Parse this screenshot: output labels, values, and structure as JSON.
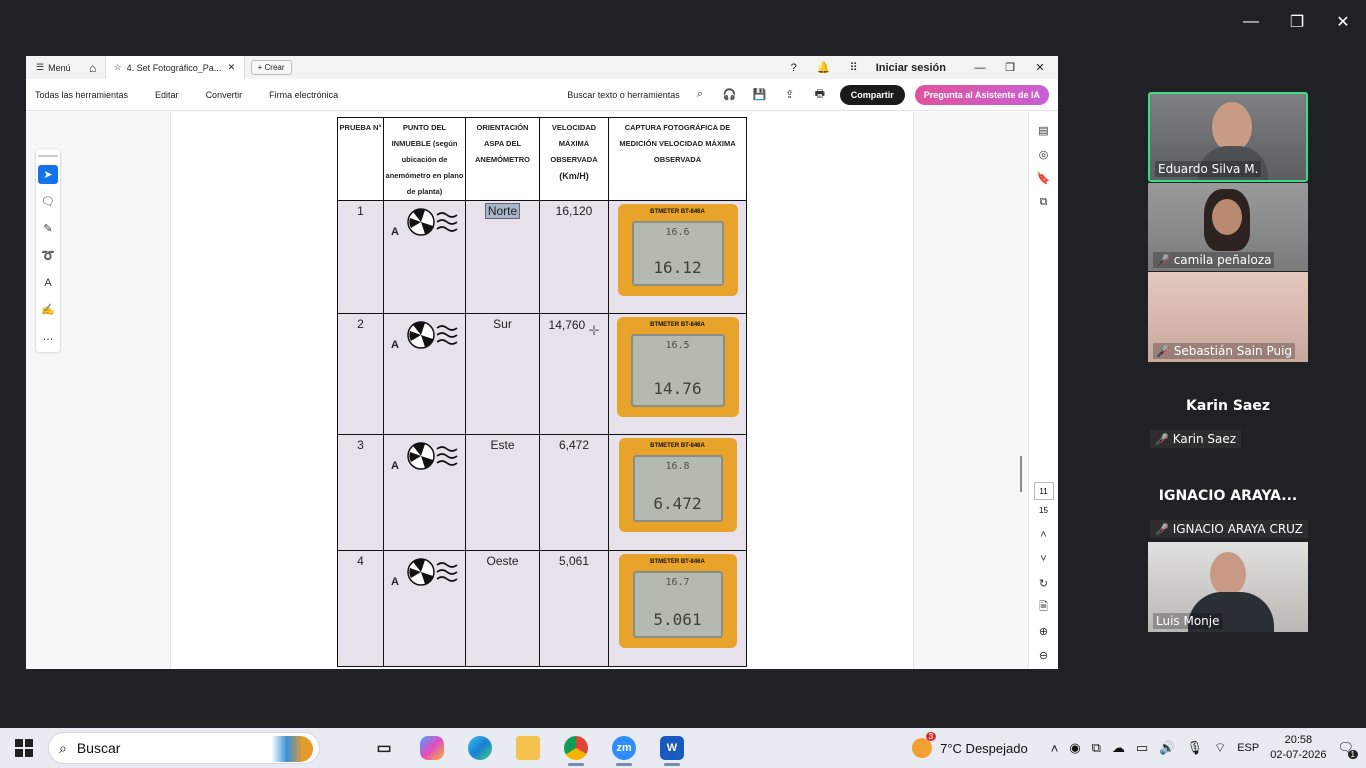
{
  "window": {
    "minimize": "—",
    "restore": "❐",
    "close": "✕"
  },
  "pdf": {
    "tabbar": {
      "menu_label": "Menú",
      "tab_title": "4. Set Fotográfico_Pa...",
      "create_label": "Crear",
      "login_label": "Iniciar sesión"
    },
    "toolbar": {
      "items": [
        "Todas las herramientas",
        "Editar",
        "Convertir",
        "Firma electrónica"
      ],
      "search_label": "Buscar texto o herramientas",
      "share_label": "Compartir",
      "ai_label": "Pregunta al Asistente de IA"
    },
    "page_nav": {
      "current": "11",
      "total": "15"
    }
  },
  "table": {
    "headers": {
      "col1": "PRUEBA N°",
      "col2": "PUNTO DEL INMUEBLE (según ubicación de anemómetro en plano de planta)",
      "col3": "ORIENTACIÓN ASPA DEL ANEMÓMETRO",
      "col4_a": "VELOCIDAD MÁXIMA OBSERVADA",
      "col4_b": "(Km/H)",
      "col5": "CAPTURA FOTOGRÁFICA DE MEDICIÓN VELOCIDAD MÁXIMA OBSERVADA"
    },
    "rows": [
      {
        "n": "1",
        "point": "A",
        "orientation": "Norte",
        "speed": "16,120",
        "meter_brand": "BTMETER BT-846A",
        "meter_small": "16.6",
        "meter_big": "16.12"
      },
      {
        "n": "2",
        "point": "A",
        "orientation": "Sur",
        "speed": "14,760",
        "meter_brand": "BTMETER BT-846A",
        "meter_small": "16.5",
        "meter_big": "14.76"
      },
      {
        "n": "3",
        "point": "A",
        "orientation": "Este",
        "speed": "6,472",
        "meter_brand": "BTMETER BT-846A",
        "meter_small": "16.8",
        "meter_big": "6.472"
      },
      {
        "n": "4",
        "point": "A",
        "orientation": "Oeste",
        "speed": "5,061",
        "meter_brand": "BTMETER BT-846A",
        "meter_small": "16.7",
        "meter_big": "5.061"
      }
    ]
  },
  "participants": {
    "eduardo": "Eduardo Silva M.",
    "camila": "camila peñaloza",
    "sebastian": "Sebastián Sain Puig",
    "karin_title": "Karin Saez",
    "karin_pill": "Karin Saez",
    "ignacio_title": "IGNACIO ARAYA...",
    "ignacio_pill": "IGNACIO ARAYA CRUZ",
    "luis": "Luis Monje"
  },
  "taskbar": {
    "search_label": "Buscar",
    "weather": "7°C  Despejado",
    "weather_badge": "3",
    "language": "ESP",
    "time": "20:58",
    "date": "02-07-2026",
    "notif_count": "1"
  }
}
